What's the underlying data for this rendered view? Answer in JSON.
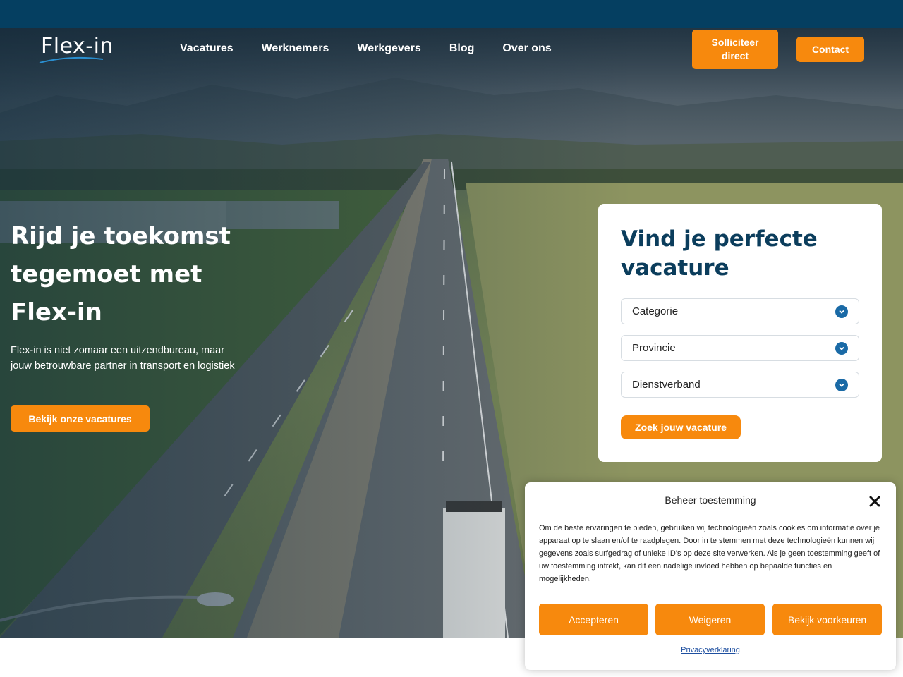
{
  "brand": {
    "logo_text": "Flex-in",
    "accent_color": "#f7890d",
    "primary_color": "#0b3d5c"
  },
  "nav": {
    "items": [
      {
        "label": "Vacatures"
      },
      {
        "label": "Werknemers"
      },
      {
        "label": "Werkgevers"
      },
      {
        "label": "Blog"
      },
      {
        "label": "Over ons"
      }
    ],
    "apply_label": "Solliciteer direct",
    "contact_label": "Contact"
  },
  "hero": {
    "title": "Rijd je toekomst tegemoet met Flex-in",
    "subtitle": "Flex-in is niet zomaar een uitzendbureau, maar jouw betrouwbare partner in transport en logistiek",
    "cta_label": "Bekijk onze vacatures"
  },
  "search": {
    "title": "Vind je perfecte vacature",
    "selects": [
      {
        "label": "Categorie",
        "icon": "chevron-down-icon"
      },
      {
        "label": "Provincie",
        "icon": "chevron-down-icon"
      },
      {
        "label": "Dienstverband",
        "icon": "chevron-down-icon"
      }
    ],
    "submit_label": "Zoek jouw vacature"
  },
  "consent": {
    "title": "Beheer toestemming",
    "close_icon": "close-icon",
    "text": "Om de beste ervaringen te bieden, gebruiken wij technologieën zoals cookies om informatie over je apparaat op te slaan en/of te raadplegen. Door in te stemmen met deze technologieën kunnen wij gegevens zoals surfgedrag of unieke ID's op deze site verwerken. Als je geen toestemming geeft of uw toestemming intrekt, kan dit een nadelige invloed hebben op bepaalde functies en mogelijkheden.",
    "accept_label": "Accepteren",
    "deny_label": "Weigeren",
    "preferences_label": "Bekijk voorkeuren",
    "privacy_link": "Privacyverklaring"
  }
}
